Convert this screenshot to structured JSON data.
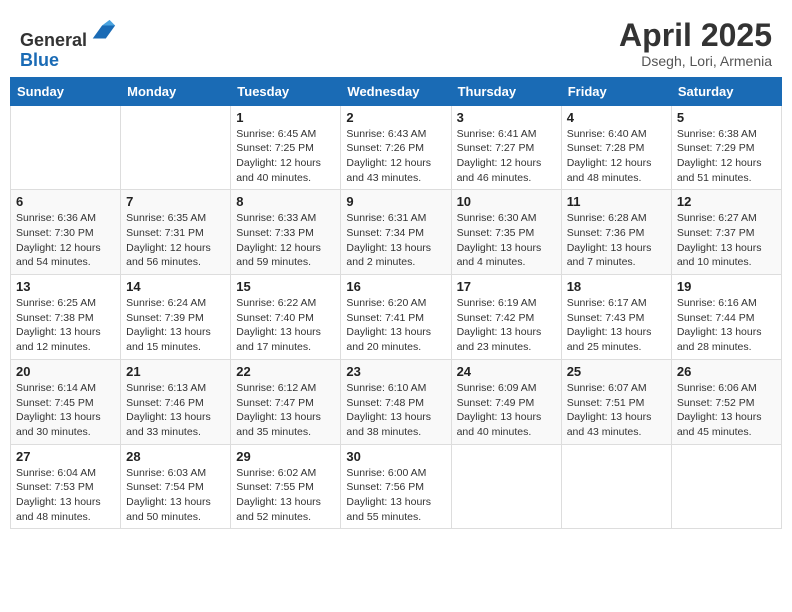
{
  "header": {
    "logo_line1": "General",
    "logo_line2": "Blue",
    "month_title": "April 2025",
    "location": "Dsegh, Lori, Armenia"
  },
  "weekdays": [
    "Sunday",
    "Monday",
    "Tuesday",
    "Wednesday",
    "Thursday",
    "Friday",
    "Saturday"
  ],
  "weeks": [
    [
      {
        "day": "",
        "info": ""
      },
      {
        "day": "",
        "info": ""
      },
      {
        "day": "1",
        "info": "Sunrise: 6:45 AM\nSunset: 7:25 PM\nDaylight: 12 hours and 40 minutes."
      },
      {
        "day": "2",
        "info": "Sunrise: 6:43 AM\nSunset: 7:26 PM\nDaylight: 12 hours and 43 minutes."
      },
      {
        "day": "3",
        "info": "Sunrise: 6:41 AM\nSunset: 7:27 PM\nDaylight: 12 hours and 46 minutes."
      },
      {
        "day": "4",
        "info": "Sunrise: 6:40 AM\nSunset: 7:28 PM\nDaylight: 12 hours and 48 minutes."
      },
      {
        "day": "5",
        "info": "Sunrise: 6:38 AM\nSunset: 7:29 PM\nDaylight: 12 hours and 51 minutes."
      }
    ],
    [
      {
        "day": "6",
        "info": "Sunrise: 6:36 AM\nSunset: 7:30 PM\nDaylight: 12 hours and 54 minutes."
      },
      {
        "day": "7",
        "info": "Sunrise: 6:35 AM\nSunset: 7:31 PM\nDaylight: 12 hours and 56 minutes."
      },
      {
        "day": "8",
        "info": "Sunrise: 6:33 AM\nSunset: 7:33 PM\nDaylight: 12 hours and 59 minutes."
      },
      {
        "day": "9",
        "info": "Sunrise: 6:31 AM\nSunset: 7:34 PM\nDaylight: 13 hours and 2 minutes."
      },
      {
        "day": "10",
        "info": "Sunrise: 6:30 AM\nSunset: 7:35 PM\nDaylight: 13 hours and 4 minutes."
      },
      {
        "day": "11",
        "info": "Sunrise: 6:28 AM\nSunset: 7:36 PM\nDaylight: 13 hours and 7 minutes."
      },
      {
        "day": "12",
        "info": "Sunrise: 6:27 AM\nSunset: 7:37 PM\nDaylight: 13 hours and 10 minutes."
      }
    ],
    [
      {
        "day": "13",
        "info": "Sunrise: 6:25 AM\nSunset: 7:38 PM\nDaylight: 13 hours and 12 minutes."
      },
      {
        "day": "14",
        "info": "Sunrise: 6:24 AM\nSunset: 7:39 PM\nDaylight: 13 hours and 15 minutes."
      },
      {
        "day": "15",
        "info": "Sunrise: 6:22 AM\nSunset: 7:40 PM\nDaylight: 13 hours and 17 minutes."
      },
      {
        "day": "16",
        "info": "Sunrise: 6:20 AM\nSunset: 7:41 PM\nDaylight: 13 hours and 20 minutes."
      },
      {
        "day": "17",
        "info": "Sunrise: 6:19 AM\nSunset: 7:42 PM\nDaylight: 13 hours and 23 minutes."
      },
      {
        "day": "18",
        "info": "Sunrise: 6:17 AM\nSunset: 7:43 PM\nDaylight: 13 hours and 25 minutes."
      },
      {
        "day": "19",
        "info": "Sunrise: 6:16 AM\nSunset: 7:44 PM\nDaylight: 13 hours and 28 minutes."
      }
    ],
    [
      {
        "day": "20",
        "info": "Sunrise: 6:14 AM\nSunset: 7:45 PM\nDaylight: 13 hours and 30 minutes."
      },
      {
        "day": "21",
        "info": "Sunrise: 6:13 AM\nSunset: 7:46 PM\nDaylight: 13 hours and 33 minutes."
      },
      {
        "day": "22",
        "info": "Sunrise: 6:12 AM\nSunset: 7:47 PM\nDaylight: 13 hours and 35 minutes."
      },
      {
        "day": "23",
        "info": "Sunrise: 6:10 AM\nSunset: 7:48 PM\nDaylight: 13 hours and 38 minutes."
      },
      {
        "day": "24",
        "info": "Sunrise: 6:09 AM\nSunset: 7:49 PM\nDaylight: 13 hours and 40 minutes."
      },
      {
        "day": "25",
        "info": "Sunrise: 6:07 AM\nSunset: 7:51 PM\nDaylight: 13 hours and 43 minutes."
      },
      {
        "day": "26",
        "info": "Sunrise: 6:06 AM\nSunset: 7:52 PM\nDaylight: 13 hours and 45 minutes."
      }
    ],
    [
      {
        "day": "27",
        "info": "Sunrise: 6:04 AM\nSunset: 7:53 PM\nDaylight: 13 hours and 48 minutes."
      },
      {
        "day": "28",
        "info": "Sunrise: 6:03 AM\nSunset: 7:54 PM\nDaylight: 13 hours and 50 minutes."
      },
      {
        "day": "29",
        "info": "Sunrise: 6:02 AM\nSunset: 7:55 PM\nDaylight: 13 hours and 52 minutes."
      },
      {
        "day": "30",
        "info": "Sunrise: 6:00 AM\nSunset: 7:56 PM\nDaylight: 13 hours and 55 minutes."
      },
      {
        "day": "",
        "info": ""
      },
      {
        "day": "",
        "info": ""
      },
      {
        "day": "",
        "info": ""
      }
    ]
  ]
}
